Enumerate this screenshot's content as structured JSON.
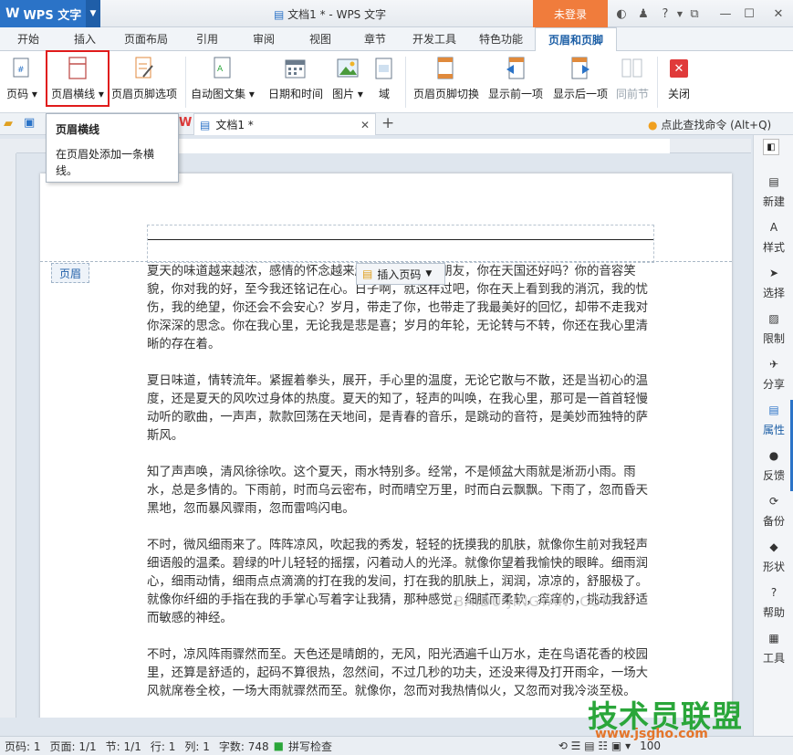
{
  "titlebar": {
    "app_name": "WPS 文字",
    "doc_title": "文档1 * - WPS 文字",
    "login": "未登录",
    "help": "?"
  },
  "tabs": [
    "开始",
    "插入",
    "页面布局",
    "引用",
    "审阅",
    "视图",
    "章节",
    "开发工具",
    "特色功能",
    "页眉和页脚"
  ],
  "active_tab": "页眉和页脚",
  "ribbon": {
    "page_number": "页码",
    "header_line": "页眉横线",
    "header_footer_options": "页眉页脚选项",
    "auto_text": "自动图文集",
    "date_time": "日期和时间",
    "picture": "图片",
    "field": "域",
    "switch": "页眉页脚切换",
    "show_prev": "显示前一项",
    "show_next": "显示后一项",
    "same_prev": "同前节",
    "close": "关闭"
  },
  "tooltip": {
    "title": "页眉横线",
    "desc": "在页眉处添加一条横线。"
  },
  "docbar": {
    "doc_tab": "文档1 *",
    "help_search": "点此查找命令 (Alt+Q)"
  },
  "page": {
    "header_label": "页眉",
    "insert_page_number": "插入页码",
    "paragraphs": [
      "夏天的味道越来越浓，感情的怀念越来越深。我失去的朋友，你在天国还好吗？你的音容笑貌，你对我的好，至今我还铭记在心。日子啊，就这样过吧，你在天上看到我的消沉，我的忧伤，我的绝望，你还会不会安心？岁月，带走了你，也带走了我最美好的回忆，却带不走我对你深深的思念。你在我心里，无论我是悲是喜；岁月的年轮，无论转与不转，你还在我心里清晰的存在着。",
      "夏日味道，情转流年。紧握着拳头，展开，手心里的温度，无论它散与不散，还是当初心的温度，还是夏天的风吹过身体的热度。夏天的知了，轻声的叫唤，在我心里，那可是一首首轻慢动听的歌曲，一声声，款款回荡在天地间，是青春的音乐，是跳动的音符，是美妙而独特的萨斯风。",
      "知了声声唤，清风徐徐吹。这个夏天，雨水特别多。经常，不是倾盆大雨就是淅沥小雨。雨水，总是多情的。下雨前，时而乌云密布，时而晴空万里，时而白云飘飘。下雨了，忽而昏天黑地，忽而暴风骤雨，忽而雷鸣闪电。",
      "不时，微风细雨来了。阵阵凉风，吹起我的秀发，轻轻的抚摸我的肌肤，就像你生前对我轻声细语般的温柔。碧绿的叶儿轻轻的摇摆，闪着动人的光泽。就像你望着我愉快的眼眸。细雨润心，细雨动情，细雨点点滴滴的打在我的发间，打在我的肌肤上，润润，凉凉的，舒服极了。就像你纤细的手指在我的手掌心写着字让我猜，那种感觉，细腻而柔软，痒痒的，挑动我舒适而敏感的神经。",
      "不时，凉风阵雨骤然而至。天色还是晴朗的，无风，阳光洒遍千山万水，走在鸟语花香的校园里，还算是舒适的，起码不算很热，忽然间，不过几秒的功夫，还没来得及打开雨伞，一场大风就席卷全校，一场大雨就骤然而至。就像你，忽而对我热情似火，又忽而对我冷淡至极。"
    ],
    "watermark": "BAIDU JINGYAN .COM"
  },
  "right_panel": [
    "新建",
    "样式",
    "选择",
    "限制",
    "分享",
    "属性",
    "反馈",
    "备份",
    "形状",
    "帮助",
    "工具"
  ],
  "status": {
    "page_no": "页码: 1",
    "pages": "页面: 1/1",
    "section": "节: 1/1",
    "row": "行: 1",
    "col": "列: 1",
    "words": "字数: 748",
    "spell": "拼写检查",
    "zoom": "100"
  },
  "brand": {
    "name": "技术员联盟",
    "url": "www.jsgho.com"
  },
  "colors": {
    "accent": "#2b73c7",
    "login": "#f07c3c",
    "highlight": "#e01b1b",
    "brand": "#2aa63a"
  }
}
